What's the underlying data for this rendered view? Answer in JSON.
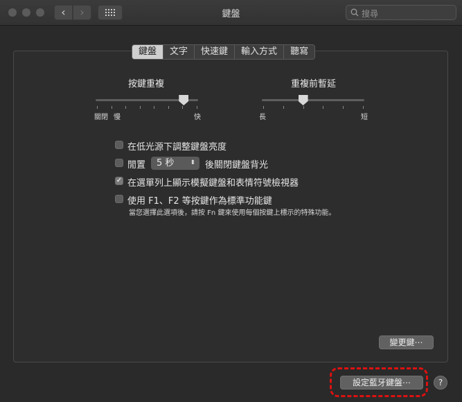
{
  "window": {
    "title": "鍵盤"
  },
  "search": {
    "placeholder": "搜尋"
  },
  "tabs": [
    "鍵盤",
    "文字",
    "快速鍵",
    "輸入方式",
    "聽寫"
  ],
  "key_repeat": {
    "title": "按鍵重複",
    "min_label": "關閉",
    "slow_label": "慢",
    "fast_label": "快",
    "level": 0.87
  },
  "delay_until_repeat": {
    "title": "重複前暫延",
    "long_label": "長",
    "short_label": "短",
    "level": 0.4
  },
  "options": {
    "adjust_brightness": {
      "label": "在低光源下調整鍵盤亮度",
      "checked": false
    },
    "backlight_off": {
      "prefix": "閒置",
      "popup_value": "5 秒",
      "suffix": "後關閉鍵盤背光",
      "checked": false
    },
    "show_viewers": {
      "label": "在選單列上顯示模擬鍵盤和表情符號檢視器",
      "checked": true
    },
    "fn_keys": {
      "label": "使用 F1、F2 等按鍵作為標準功能鍵",
      "checked": false,
      "note": "當您選擇此選項後，請按 Fn 鍵來使用每個按鍵上標示的特殊功能。"
    }
  },
  "buttons": {
    "modifier_keys": "變更鍵⋯",
    "bluetooth_setup": "設定藍牙鍵盤⋯",
    "help": "?"
  }
}
